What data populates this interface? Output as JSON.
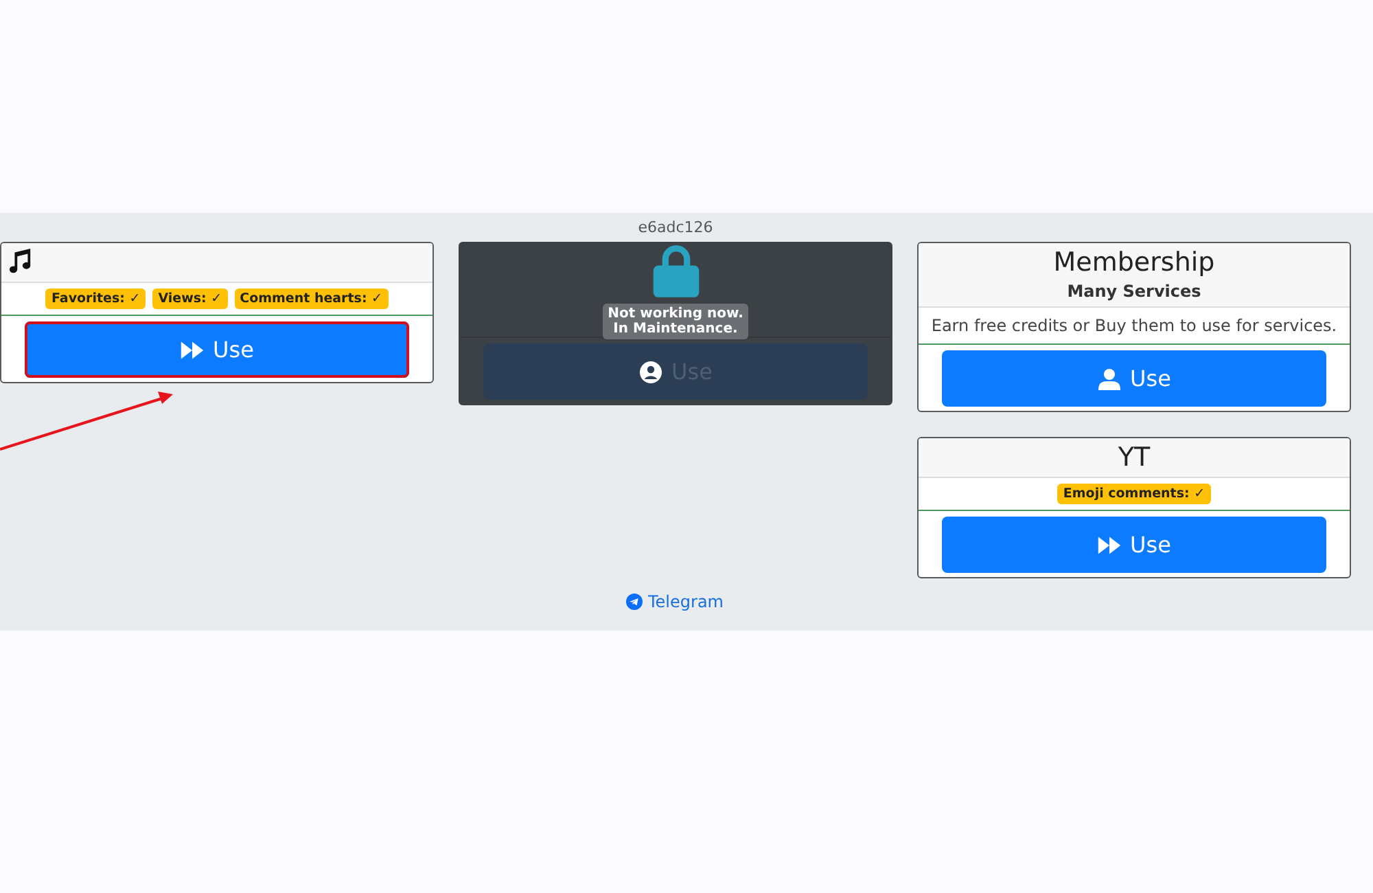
{
  "columns": [
    [
      {
        "kind": "icon-header",
        "badges": [
          {
            "label": "Favorites: ✓"
          },
          {
            "label": "Views: ✓"
          },
          {
            "label": "Comment hearts: ✓"
          }
        ],
        "button": {
          "label": "Use",
          "kind": "forward"
        },
        "maintenance": false,
        "highlighted": true
      }
    ],
    [
      {
        "kind": "maintenance",
        "label_above": "e6adc126",
        "button": {
          "label": "Use",
          "kind": "user-circle"
        },
        "maintenance": true,
        "maintenance_message": [
          "Not working now.",
          "In Maintenance."
        ],
        "highlighted": false
      }
    ],
    [
      {
        "kind": "title",
        "title": "Membership",
        "subtitle": "Many Services",
        "description": "Earn free credits or Buy them to use for services.",
        "button": {
          "label": "Use",
          "kind": "user"
        },
        "maintenance": false,
        "highlighted": false
      },
      {
        "kind": "title",
        "title": "YT",
        "badges": [
          {
            "label": "Emoji comments: ✓"
          }
        ],
        "button": {
          "label": "Use",
          "kind": "forward"
        },
        "maintenance": false,
        "highlighted": false
      }
    ]
  ],
  "footer_link": {
    "label": "Telegram"
  }
}
